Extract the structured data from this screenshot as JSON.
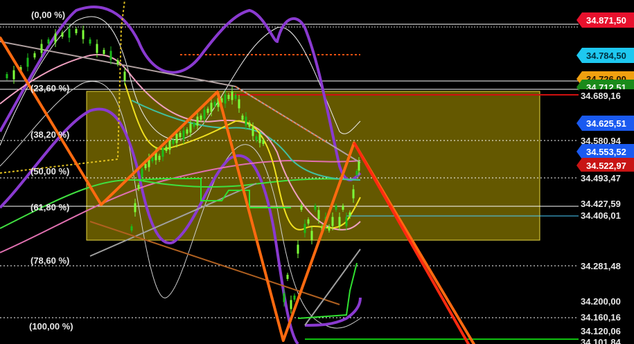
{
  "chart_data": {
    "type": "line",
    "grid": false,
    "theme": {
      "background": "#000000",
      "zone_fill": "#8a7a00",
      "zone_border": "#e6d640"
    },
    "fibonacci_levels": [
      {
        "label": "(0,00 %)"
      },
      {
        "label": "(23,60 %)"
      },
      {
        "label": "(38,20 %)"
      },
      {
        "label": "(50,00 %)"
      },
      {
        "label": "(61,80 %)"
      },
      {
        "label": "(78,60 %)"
      },
      {
        "label": "(100,00 %)"
      }
    ],
    "price_tags": [
      {
        "label": "34.871,50",
        "color": "#e8112d",
        "text_color": "#ffffff"
      },
      {
        "label": "34.784,50",
        "color": "#1ec8f0",
        "text_color": "#003040"
      },
      {
        "label": "34.726,00",
        "color": "#f0a010",
        "text_color": "#201000"
      },
      {
        "label": "34.712,51",
        "color": "#1a8a1a",
        "text_color": "#ffffff"
      },
      {
        "label": "34.689,16",
        "color": "#ffffff",
        "text_color": "#000000"
      },
      {
        "label": "34.625,51",
        "color": "#1a5af0",
        "text_color": "#ffffff"
      },
      {
        "label": "34.580,94",
        "color": "#ffffff",
        "text_color": "#000000"
      },
      {
        "label": "34.553,52",
        "color": "#1a5af0",
        "text_color": "#ffffff"
      },
      {
        "label": "34.522,97",
        "color": "#c81414",
        "text_color": "#ffffff"
      },
      {
        "label": "34.493,47",
        "color": "#ffffff",
        "text_color": "#000000"
      },
      {
        "label": "34.427,59",
        "color": "#ffffff",
        "text_color": "#000000"
      },
      {
        "label": "34.406,01",
        "color": "#ffffff",
        "text_color": "#000000"
      }
    ],
    "axis_labels": [
      "34.281,48",
      "34.200,00",
      "34.160,16",
      "34.120,06",
      "34.101,84"
    ],
    "zigzag": [
      {
        "name": "",
        "color": "#ff6a10",
        "points": [
          [
            0,
            34830
          ],
          [
            20,
            34430
          ],
          [
            43,
            34700
          ],
          [
            56,
            34105
          ],
          [
            70,
            34578
          ],
          [
            95,
            34070
          ]
        ]
      }
    ]
  }
}
